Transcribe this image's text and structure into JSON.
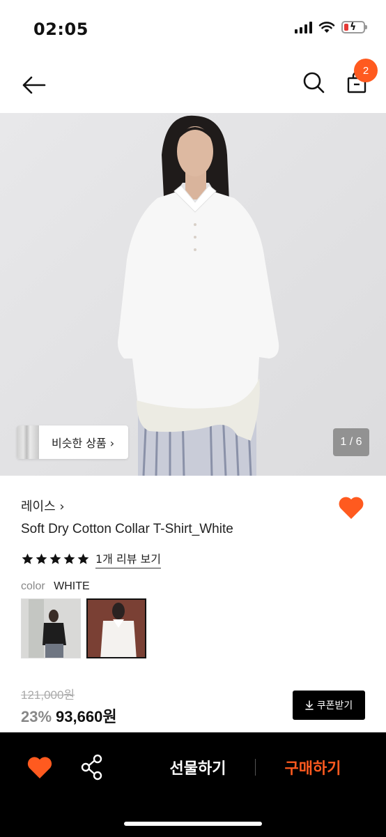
{
  "status_bar": {
    "time": "02:05"
  },
  "header": {
    "cart_count": "2"
  },
  "gallery": {
    "similar_label": "비슷한 상품 ›",
    "page_indicator": "1 / 6"
  },
  "product": {
    "brand": "레이스 ›",
    "name": "Soft Dry Cotton Collar T-Shirt_White",
    "rating_stars": 5,
    "review_link": "1개 리뷰 보기",
    "color_label": "color",
    "color_value": "WHITE",
    "original_price": "121,000원",
    "discount": "23%",
    "sale_price": "93,660원",
    "coupon_label": "쿠폰받기"
  },
  "bottom_bar": {
    "gift_label": "선물하기",
    "buy_label": "구매하기"
  },
  "colors": {
    "accent": "#ff5a1f",
    "dark": "#000000",
    "muted": "#888888"
  }
}
